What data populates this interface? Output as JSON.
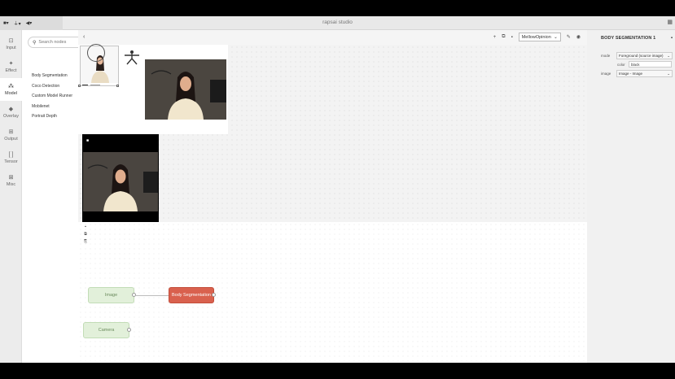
{
  "app": {
    "title": "rapsai studio",
    "titlebar_left_icons": [
      "video-icon",
      "chevron-down-icon",
      "mic-icon",
      "chevron-down-icon",
      "speaker-icon",
      "chevron-down-icon"
    ]
  },
  "sidebar": {
    "items": [
      {
        "label": "Input",
        "icon": "input-icon"
      },
      {
        "label": "Effect",
        "icon": "effect-icon"
      },
      {
        "label": "Model",
        "icon": "model-icon",
        "active": true
      },
      {
        "label": "Overlay",
        "icon": "overlay-icon"
      },
      {
        "label": "Output",
        "icon": "output-icon"
      },
      {
        "label": "Tensor",
        "icon": "tensor-icon"
      },
      {
        "label": "Misc",
        "icon": "misc-icon"
      }
    ]
  },
  "search": {
    "placeholder": "Search nodes"
  },
  "nodes_list": [
    "Body Segmentation",
    "Coco Detection",
    "Custom Model Runner",
    "Mobilenet",
    "Portrait Depth"
  ],
  "toolbar": {
    "preset": "MellowOpinion",
    "icons": [
      "add-icon",
      "copy-icon",
      "trash-icon",
      "edit-icon",
      "github-icon"
    ]
  },
  "graph": {
    "nodes": [
      {
        "id": "image",
        "label": "Image"
      },
      {
        "id": "body_seg",
        "label": "Body Segmentation"
      },
      {
        "id": "camera",
        "label": "Camera"
      }
    ]
  },
  "inspector": {
    "title": "BODY SEGMENTATION 1",
    "mode_label": "mode",
    "mode_value": "Foreground (source image)",
    "color_label": "color",
    "color_value": "black",
    "image_label": "image",
    "image_value": "Image - Image"
  },
  "colors": {
    "model_node": "#d9614e",
    "input_node": "#e2f0da"
  }
}
